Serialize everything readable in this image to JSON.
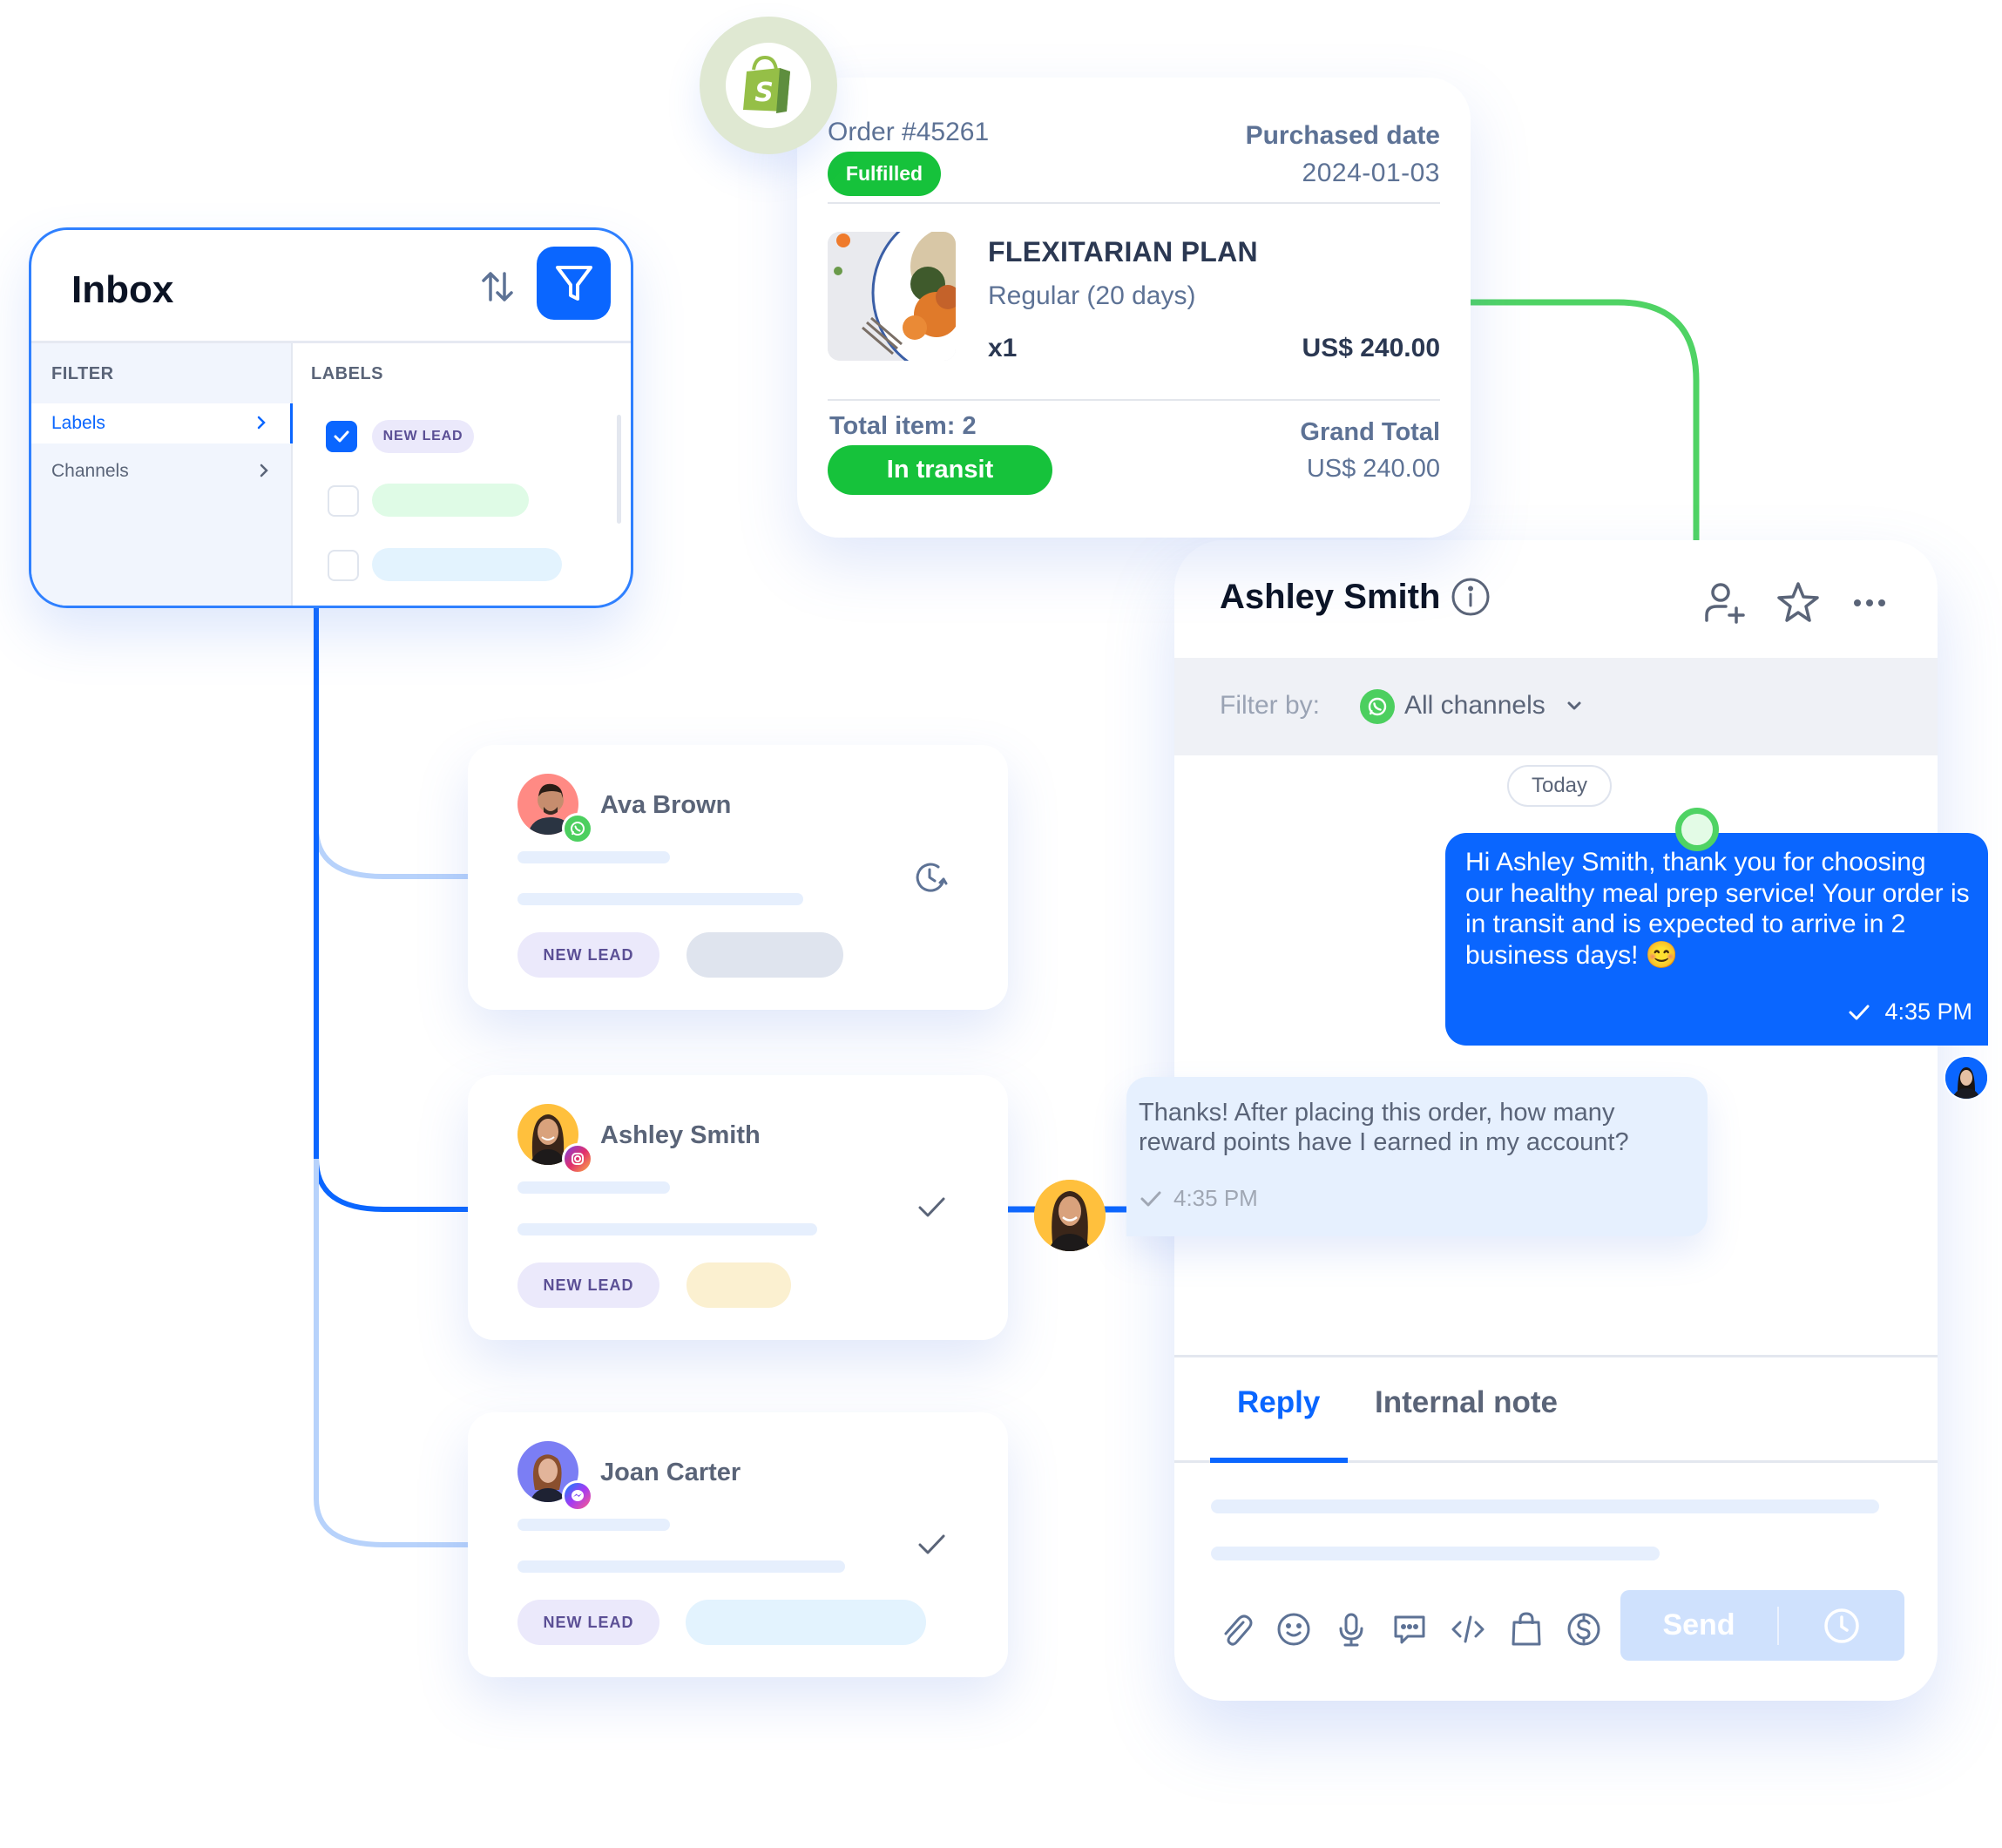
{
  "colors": {
    "primary": "#0a66ff",
    "success": "#16c23b",
    "whatsapp": "#4ccf5f",
    "connector_green": "#4fd364",
    "label_purple_bg": "#ebe9fb",
    "label_purple_text": "#5b4f95"
  },
  "inbox": {
    "title": "Inbox",
    "sort_icon": "sort-arrows-icon",
    "filter_icon": "funnel-icon",
    "filter_heading": "FILTER",
    "filter_items": [
      {
        "label": "Labels",
        "active": true
      },
      {
        "label": "Channels",
        "active": false
      }
    ],
    "labels_heading": "LABELS",
    "labels": [
      {
        "text": "NEW LEAD",
        "checked": true,
        "color": "#ebe9fb"
      },
      {
        "text": "",
        "checked": false,
        "color": "#dffbe6"
      },
      {
        "text": "",
        "checked": false,
        "color": "#e3f3fe"
      }
    ]
  },
  "order": {
    "integration_icon": "shopify-bag-icon",
    "order_number": "Order #45261",
    "fulfillment_status": "Fulfilled",
    "purchased_date_label": "Purchased date",
    "purchased_date": "2024-01-03",
    "item": {
      "title": "FLEXITARIAN PLAN",
      "variant": "Regular (20 days)",
      "quantity": "x1",
      "price": "US$ 240.00"
    },
    "total_items": "Total item: 2",
    "shipping_status": "In transit",
    "grand_total_label": "Grand Total",
    "grand_total": "US$ 240.00"
  },
  "conversations": [
    {
      "name": "Ava Brown",
      "channel": "whatsapp",
      "status_icon": "snooze-clock-icon",
      "label": "NEW LEAD",
      "second_label_color": "#dfe4ee",
      "avatar_bg": "#ff8a84"
    },
    {
      "name": "Ashley Smith",
      "channel": "instagram",
      "status_icon": "check-icon",
      "label": "NEW LEAD",
      "second_label_color": "#fbf0d0",
      "avatar_bg": "#ffc03d"
    },
    {
      "name": "Joan Carter",
      "channel": "messenger",
      "status_icon": "check-icon",
      "label": "NEW LEAD",
      "second_label_color": "#e3f3fe",
      "avatar_bg": "#7b7ef4"
    }
  ],
  "chat": {
    "contact_name": "Ashley Smith",
    "filter_by_label": "Filter by:",
    "channel_filter": "All channels",
    "date_divider": "Today",
    "messages": [
      {
        "direction": "outgoing",
        "text": "Hi Ashley Smith, thank you for choosing our healthy meal prep service!  Your order is in transit and is expected to arrive in 2 business days! 😊",
        "time": "4:35 PM",
        "status": "sent"
      },
      {
        "direction": "incoming",
        "text": "Thanks! After placing this order, how many reward points have I earned in my account?",
        "time": "4:35 PM",
        "status": "read"
      }
    ],
    "tabs": [
      {
        "label": "Reply",
        "active": true
      },
      {
        "label": "Internal note",
        "active": false
      }
    ],
    "toolbar_icons": [
      "paperclip-icon",
      "emoji-icon",
      "microphone-icon",
      "chat-template-icon",
      "code-icon",
      "shopping-bag-icon",
      "dollar-icon"
    ],
    "send_label": "Send",
    "send_enabled": false
  }
}
